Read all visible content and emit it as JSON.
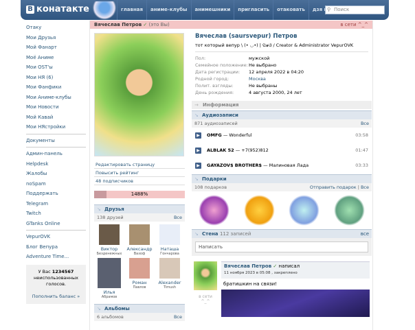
{
  "header": {
    "logo_letter": "В",
    "logo_text": "конатакте",
    "nav": [
      "главная",
      "аниме-клубы",
      "анимешники",
      "пригласить",
      "отаковать",
      "дзя нэ"
    ],
    "search_placeholder": "Поиск"
  },
  "sidebar": {
    "groups": [
      [
        "Отаку",
        "Мои Друзья",
        "Мой Фанарт",
        "Моё Аниме",
        "Мои OST'ы",
        "Мои НЯ (6)",
        "Мои Фанфики",
        "Мои Аниме-клубы",
        "Мои Новости",
        "Мой Кавай",
        "Мои НЯстройки"
      ],
      [
        "Документы"
      ],
      [
        "Админ-панель",
        "Helpdesk",
        "Жалобы",
        "noSpam",
        "Поддержать",
        "Telegram",
        "Twitch",
        "GTanks Online"
      ],
      [
        "VepurOVK",
        "Блог Вепура",
        "Adventure Time..."
      ]
    ],
    "votes": {
      "prefix": "У Вас",
      "count": "1234567",
      "suffix": "неиспользованных голосов.",
      "topup": "Пополнить баланс »"
    }
  },
  "topbar": {
    "name": "Вячеслав Петров",
    "check": "✓",
    "you": "(это Вы)",
    "online": "в сети ^_^"
  },
  "profile": {
    "full_name": "Вячеслав (saursvepur) Петров",
    "status": "тот который вепур \\ (• ◡•) | ପ๑ଓ / Creator & Administrator VepurOVK",
    "fields": [
      {
        "k": "Пол:",
        "v": "мужской"
      },
      {
        "k": "Семейное положение:",
        "v": "Не выбрано"
      },
      {
        "k": "Дата регистрации:",
        "v": "12 апреля 2022 в 04:20"
      },
      {
        "k": "Родной город:",
        "v": "Москва"
      },
      {
        "k": "Полит. взгляды:",
        "v": "Не выбраны"
      },
      {
        "k": "День рождения:",
        "v": "4 августа 2000, 24 лет"
      }
    ],
    "info_label": "Информация"
  },
  "left": {
    "links": [
      "Редактировать страницу",
      "Повысить рейтинг",
      "48 подписчиков"
    ],
    "rating": "1488%",
    "rating_fill": 0.14,
    "friends": {
      "title": "Друзья",
      "count": "138 друзей",
      "all": "Все",
      "list": [
        {
          "n": "Виктор",
          "s": "Безденежных"
        },
        {
          "n": "Александр",
          "s": "Вазоф"
        },
        {
          "n": "Наташа",
          "s": "Гончарова"
        },
        {
          "n": "Илья",
          "s": "Абрамов"
        },
        {
          "n": "Роман",
          "s": "Павлов"
        },
        {
          "n": "Alexander",
          "s": "Timush"
        }
      ]
    },
    "albums": {
      "title": "Альбомы",
      "count": "6 альбомов",
      "all": "Все"
    }
  },
  "audio": {
    "title": "Аудиозаписи",
    "count": "871 аудиозаписей",
    "all": "Все",
    "tracks": [
      {
        "artist": "OMFG",
        "title": "Wonderful",
        "dur": "03:58"
      },
      {
        "artist": "ALBLAK 52",
        "title": "+7(952)812",
        "dur": "01:47"
      },
      {
        "artist": "GAYAZOV$ BROTHER$",
        "title": "Малиновая Лада",
        "dur": "03:33"
      }
    ],
    "sep": " — "
  },
  "gifts": {
    "title": "Подарки",
    "count": "108 подарков",
    "send": "Отправить подарок",
    "sep": " | ",
    "all": "Все"
  },
  "wall": {
    "title": "Стена",
    "count": "112 записей",
    "all": "все",
    "placeholder": "Написать",
    "post": {
      "author": "Вячеслав Петров",
      "check": "✓",
      "action": "написал",
      "date": "11 ноября 2023 в 05:08 , закреплено",
      "text": "братишкин на связи!",
      "online": "в сети ^_^"
    }
  }
}
